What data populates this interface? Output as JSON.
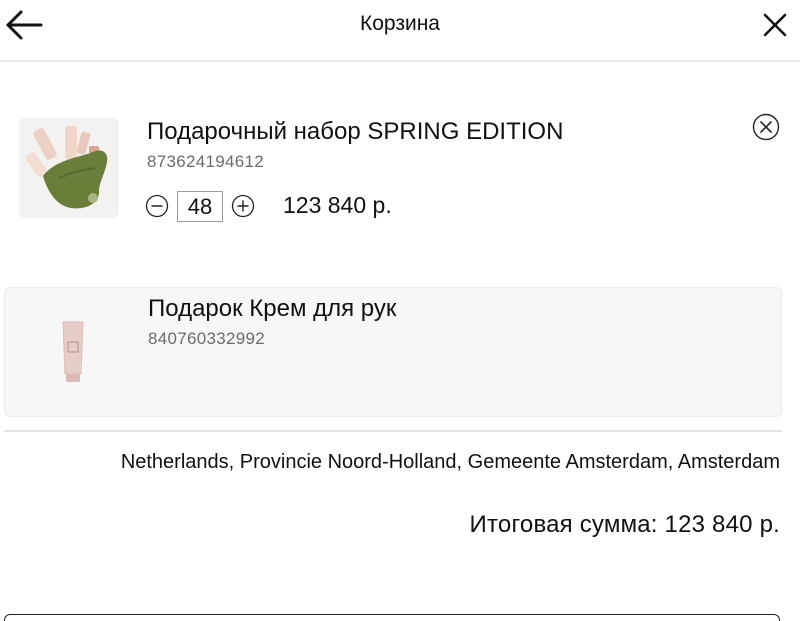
{
  "header": {
    "title": "Корзина",
    "back_icon": "arrow-left-icon",
    "close_icon": "close-icon"
  },
  "cart": {
    "items": [
      {
        "name": "Подарочный набор SPRING EDITION",
        "sku": "873624194612",
        "quantity": "48",
        "price": "123 840 р.",
        "remove_icon": "remove-circle-x-icon",
        "minus_icon": "minus-circle-icon",
        "plus_icon": "plus-circle-icon"
      },
      {
        "name": "Подарок Крем для рук",
        "sku": "840760332992"
      }
    ]
  },
  "summary": {
    "address": "Netherlands, Provincie Noord-Holland, Gemeente Amsterdam, Amsterdam",
    "total": "Итоговая сумма: 123 840 р."
  },
  "colors": {
    "text": "#111111",
    "muted": "#6b6b6b",
    "divider": "#e2e2e2",
    "gift_card_bg": "#f7f7f7",
    "product_green": "#6b7d3a"
  }
}
